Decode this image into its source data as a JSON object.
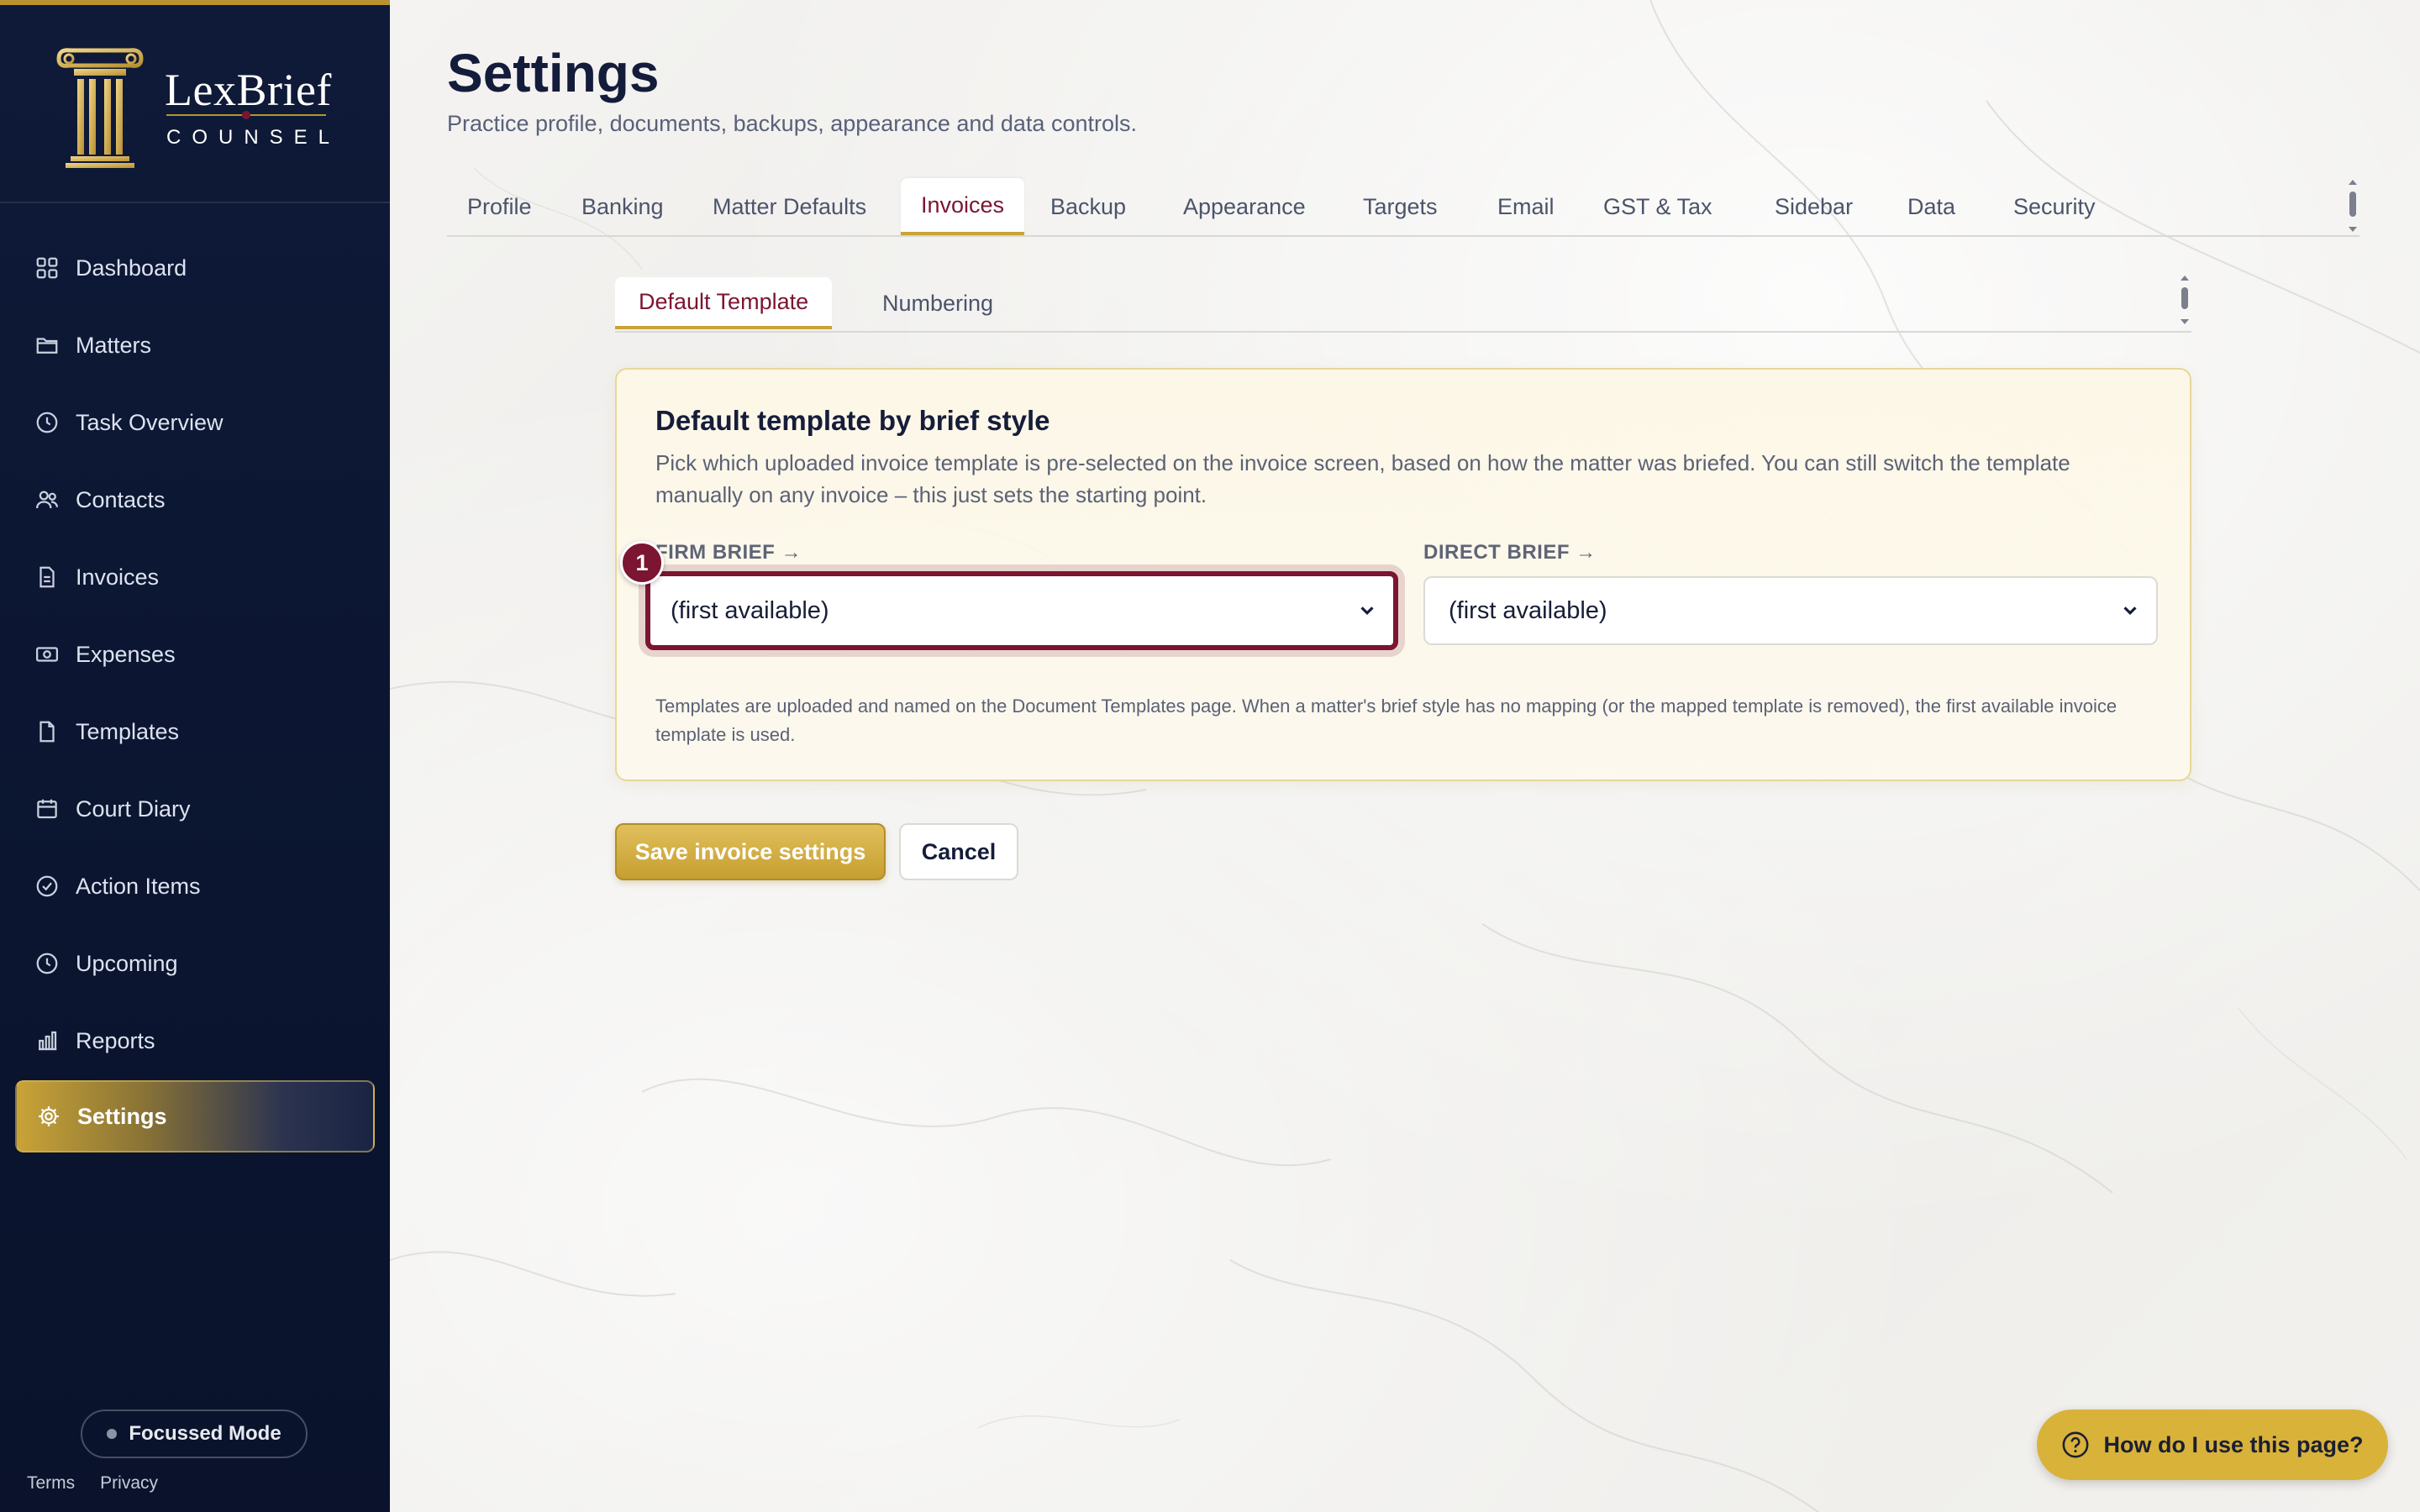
{
  "app": {
    "brand_name": "LexBrief",
    "brand_sub": "COUNSEL"
  },
  "sidebar": {
    "items": [
      {
        "label": "Dashboard",
        "icon": "grid-icon"
      },
      {
        "label": "Matters",
        "icon": "folder-icon"
      },
      {
        "label": "Task Overview",
        "icon": "clock-icon"
      },
      {
        "label": "Contacts",
        "icon": "users-icon"
      },
      {
        "label": "Invoices",
        "icon": "file-text-icon"
      },
      {
        "label": "Expenses",
        "icon": "banknote-icon"
      },
      {
        "label": "Templates",
        "icon": "file-icon"
      },
      {
        "label": "Court Diary",
        "icon": "calendar-icon"
      },
      {
        "label": "Action Items",
        "icon": "check-circle-icon"
      },
      {
        "label": "Upcoming",
        "icon": "clock-icon"
      },
      {
        "label": "Reports",
        "icon": "bar-chart-icon"
      },
      {
        "label": "Settings",
        "icon": "gear-icon",
        "active": true
      }
    ],
    "focus_mode_label": "Focussed Mode",
    "footer_links": [
      "Terms",
      "Privacy"
    ]
  },
  "header": {
    "title": "Settings",
    "subtitle": "Practice profile, documents, backups, appearance and data controls."
  },
  "tabs": [
    "Profile",
    "Banking",
    "Matter Defaults",
    "Invoices",
    "Backup",
    "Appearance",
    "Targets",
    "Email",
    "GST & Tax",
    "Sidebar",
    "Data",
    "Security"
  ],
  "active_tab": "Invoices",
  "subtabs": [
    "Default Template",
    "Numbering"
  ],
  "active_subtab": "Default Template",
  "card": {
    "title": "Default template by brief style",
    "description": "Pick which uploaded invoice template is pre-selected on the invoice screen, based on how the matter was briefed. You can still switch the template manually on any invoice – this just sets the starting point.",
    "firm_label": "FIRM BRIEF →",
    "firm_value": "(first available)",
    "direct_label": "DIRECT BRIEF →",
    "direct_value": "(first available)",
    "step_badge": "1",
    "note": "Templates are uploaded and named on the Document Templates page. When a matter's brief style has no mapping (or the mapped template is removed), the first available invoice template is used."
  },
  "actions": {
    "save_label": "Save invoice settings",
    "cancel_label": "Cancel"
  },
  "help": {
    "label": "How do I use this page?"
  },
  "colors": {
    "sidebar_bg": "#0e1a38",
    "accent_gold": "#c9a337",
    "accent_burgundy": "#7b1531"
  }
}
